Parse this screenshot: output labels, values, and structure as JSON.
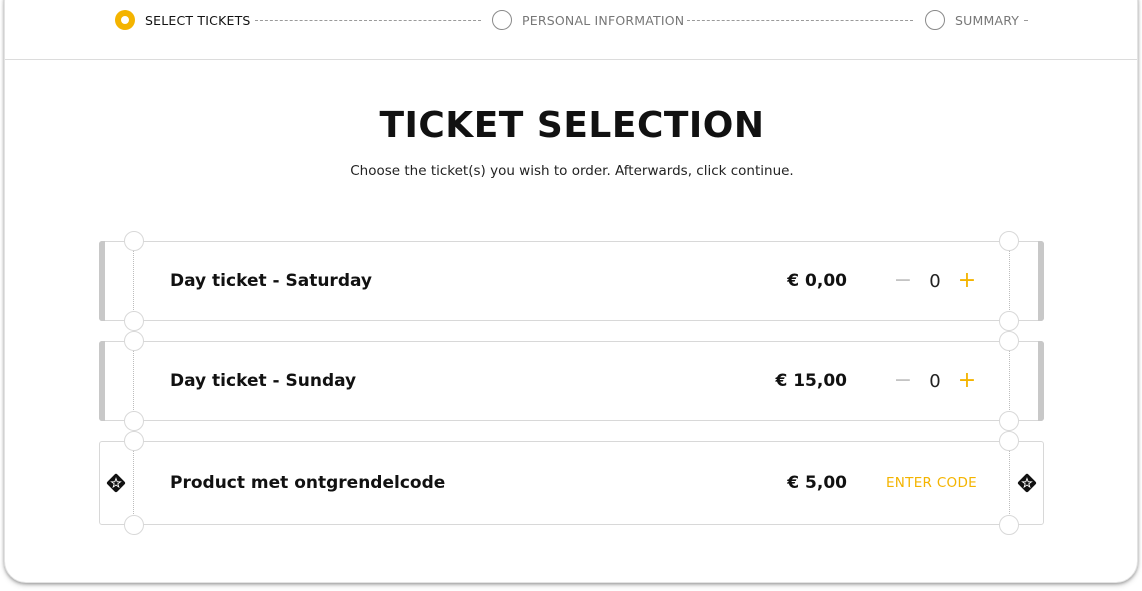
{
  "stepper": {
    "steps": [
      {
        "label": "SELECT TICKETS",
        "state": "active"
      },
      {
        "label": "PERSONAL INFORMATION",
        "state": "inactive"
      },
      {
        "label": "SUMMARY",
        "state": "inactive"
      }
    ]
  },
  "header": {
    "title": "TICKET SELECTION",
    "subtitle": "Choose the ticket(s) you wish to order. Afterwards, click continue."
  },
  "tickets": [
    {
      "name": "Day ticket - Saturday",
      "price": "€ 0,00",
      "quantity": "0",
      "minus": "−",
      "plus": "+"
    },
    {
      "name": "Day ticket - Sunday",
      "price": "€ 15,00",
      "quantity": "0",
      "minus": "−",
      "plus": "+"
    },
    {
      "name": "Product met ontgrendelcode",
      "price": "€ 5,00",
      "action_label": "ENTER CODE",
      "icon": "locked-ticket-icon"
    }
  ],
  "colors": {
    "accent": "#f4b400",
    "text": "#111111",
    "muted": "#777777",
    "border": "#d8d8d8",
    "edge": "#c8c8c8"
  }
}
